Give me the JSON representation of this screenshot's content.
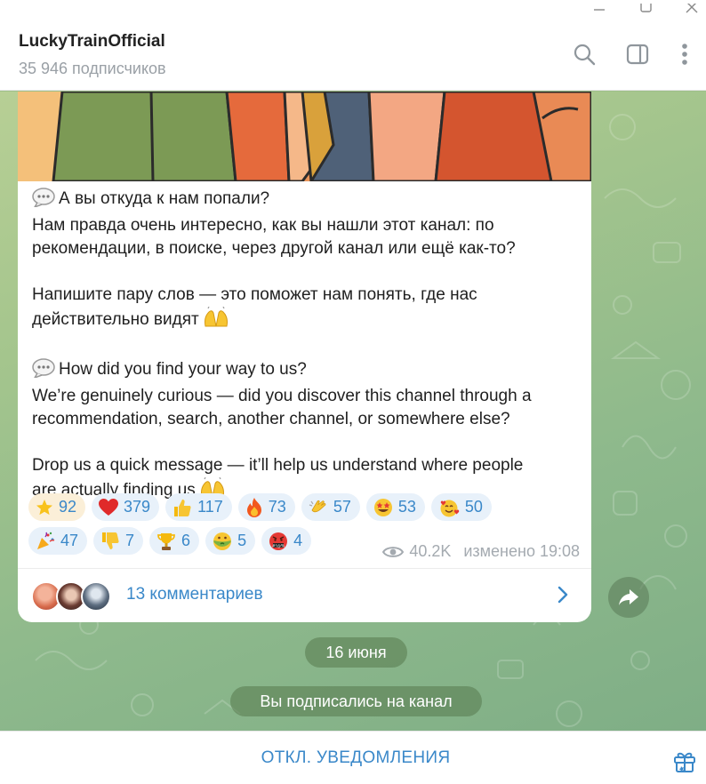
{
  "window": {
    "controls": [
      "minimize",
      "maximize",
      "close"
    ]
  },
  "header": {
    "channel_name": "LuckyTrainOfficial",
    "subscribers": "35 946 подписчиков",
    "icons": [
      "search-icon",
      "side-panel-icon",
      "more-vertical-icon"
    ]
  },
  "message": {
    "ru_question": "А вы откуда к нам попали?",
    "ru_line1": "Нам правда очень интересно, как вы нашли этот канал: по",
    "ru_line2": "рекомендации, в поиске, через другой канал или ещё как-то?",
    "ru_line3": "Напишите пару слов — это поможет нам понять, где нас",
    "ru_line4": "действительно видят",
    "en_question": "How did you find your way to us?",
    "en_line1": "We’re genuinely curious — did you discover this channel through a",
    "en_line2": "recommendation, search, another channel, or somewhere else?",
    "en_line3": "Drop us a quick message — it’ll help us understand where people",
    "en_line4": "are actually finding us",
    "reactions": [
      {
        "emoji": "star-icon",
        "count": "92",
        "chosen": true
      },
      {
        "emoji": "red-heart-icon",
        "count": "379"
      },
      {
        "emoji": "thumbs-up-icon",
        "count": "117"
      },
      {
        "emoji": "fire-icon",
        "count": "73"
      },
      {
        "emoji": "clapping-hands-icon",
        "count": "57"
      },
      {
        "emoji": "star-struck-face-icon",
        "count": "53"
      },
      {
        "emoji": "smiling-face-with-hearts-icon",
        "count": "50"
      },
      {
        "emoji": "party-popper-icon",
        "count": "47"
      },
      {
        "emoji": "thumbs-down-icon",
        "count": "7"
      },
      {
        "emoji": "trophy-icon",
        "count": "6"
      },
      {
        "emoji": "nauseated-face-icon",
        "count": "5"
      },
      {
        "emoji": "swearing-face-icon",
        "count": "4"
      }
    ],
    "views": "40.2K",
    "edited_time": "изменено 19:08",
    "comments_label": "13 комментариев"
  },
  "service": {
    "date": "16 июня",
    "subscribed": "Вы подписались на канал"
  },
  "bottom_bar": {
    "mute_label": "ОТКЛ. УВЕДОМЛЕНИЯ"
  },
  "colors": {
    "accent": "#3a88c9",
    "reaction_bg": "#e8f1fa",
    "chosen_reaction_bg": "#fbefd8",
    "service_pill": "#5c8054"
  }
}
